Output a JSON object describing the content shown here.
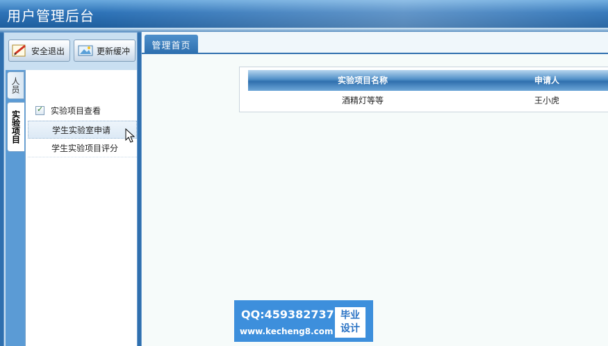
{
  "header": {
    "title": "用户管理后台"
  },
  "toolbar": {
    "logout_label": "安全退出",
    "refresh_label": "更新缓冲"
  },
  "sidebar": {
    "tabs": [
      {
        "label": "人员",
        "active": false
      },
      {
        "label": "实验项目",
        "active": true
      }
    ],
    "section_title": "实验项目查看",
    "items": [
      {
        "label": "学生实验室申请",
        "hover": true
      },
      {
        "label": "学生实验项目评分",
        "hover": false
      }
    ]
  },
  "main": {
    "tab_label": "管理首页",
    "table": {
      "columns": [
        "实验项目名称",
        "申请人"
      ],
      "rows": [
        [
          "酒精灯等等",
          "王小虎"
        ]
      ]
    }
  },
  "watermark": {
    "qq": "QQ:459382737",
    "url": "www.kecheng8.com",
    "badge_line1": "毕业",
    "badge_line2": "设计"
  },
  "colors": {
    "header_blue": "#2e73b8",
    "panel_blue": "#2f6fae",
    "tab_blue": "#2d6faf",
    "watermark_blue": "#3d8fdc"
  }
}
